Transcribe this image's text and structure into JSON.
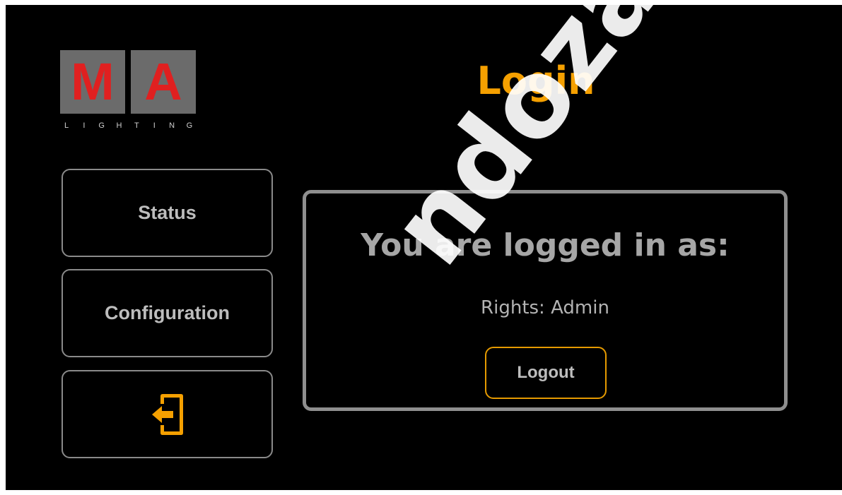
{
  "logo": {
    "letters": [
      "M",
      "A"
    ],
    "subtitle": [
      "L",
      "I",
      "G",
      "H",
      "T",
      "I",
      "N",
      "G"
    ],
    "colors": {
      "box": "#6b6b6b",
      "letter": "#e02020"
    }
  },
  "page": {
    "title": "Login"
  },
  "nav": {
    "status_label": "Status",
    "configuration_label": "Configuration",
    "login_icon": "login-door-icon"
  },
  "panel": {
    "heading": "You are logged in as:",
    "rights": "Rights: Admin",
    "logout_label": "Logout"
  },
  "watermark": {
    "text": "ndoza.com."
  },
  "colors": {
    "accent": "#f5a000",
    "border": "#8f8f8f",
    "background": "#000000"
  }
}
